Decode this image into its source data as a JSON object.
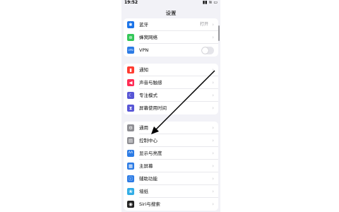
{
  "status": {
    "time": "19:52",
    "icons": "▮▮ ≋ ▭"
  },
  "title": "设置",
  "groups": [
    {
      "rows": [
        {
          "icon": "✱",
          "color": "#1a73e8",
          "label": "蓝牙",
          "value": "打开"
        },
        {
          "icon": "⊛",
          "color": "#34c759",
          "label": "蜂窝网络",
          "value": ""
        },
        {
          "icon": "VPN",
          "color": "#2c7be5",
          "label": "VPN",
          "value": "",
          "toggle": false
        }
      ]
    },
    {
      "rows": [
        {
          "icon": "▮",
          "color": "#ff3b30",
          "label": "通知"
        },
        {
          "icon": "◀",
          "color": "#ff2d55",
          "label": "声音与触感"
        },
        {
          "icon": "☾",
          "color": "#5856d6",
          "label": "专注模式"
        },
        {
          "icon": "⧗",
          "color": "#5856d6",
          "label": "屏幕使用时间"
        }
      ]
    },
    {
      "rows": [
        {
          "icon": "⚙",
          "color": "#8e8e93",
          "label": "通用"
        },
        {
          "icon": "▤",
          "color": "#8e8e93",
          "label": "控制中心"
        },
        {
          "icon": "AA",
          "color": "#2c7be5",
          "label": "显示与亮度"
        },
        {
          "icon": "▦",
          "color": "#2c7be5",
          "label": "主屏幕"
        },
        {
          "icon": "ⓘ",
          "color": "#2c7be5",
          "label": "辅助功能"
        },
        {
          "icon": "❀",
          "color": "#32ade6",
          "label": "墙纸"
        },
        {
          "icon": "◉",
          "color": "#222222",
          "label": "Siri与搜索"
        }
      ]
    }
  ]
}
